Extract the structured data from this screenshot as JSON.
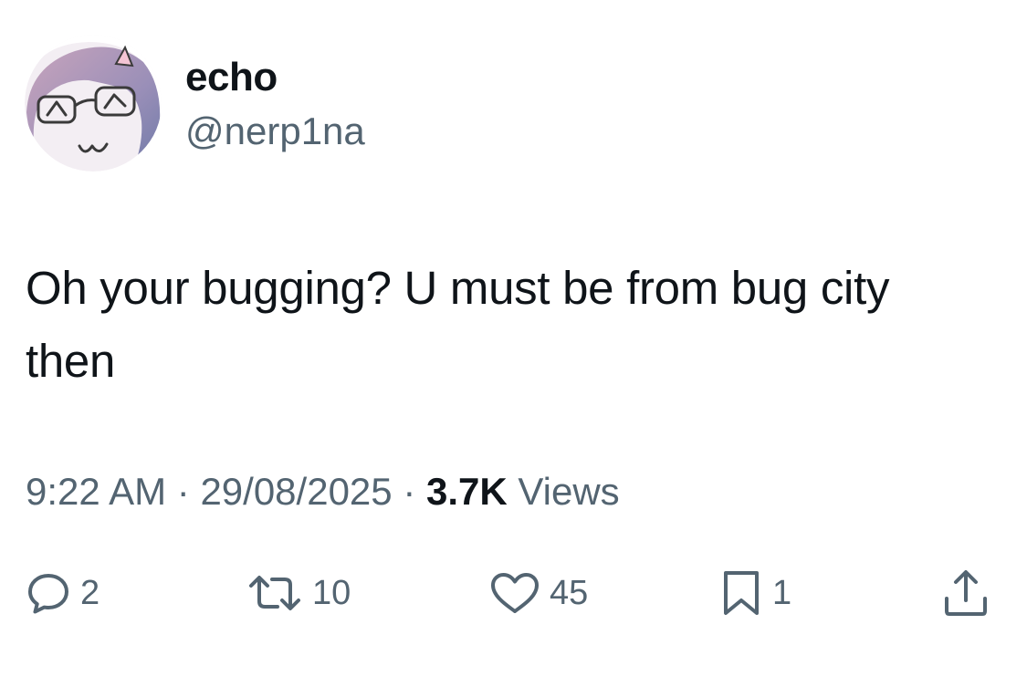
{
  "user": {
    "display_name": "echo",
    "handle": "@nerp1na"
  },
  "tweet": {
    "text": "Oh your bugging? U must be from bug city then"
  },
  "meta": {
    "time": "9:22 AM",
    "separator": " · ",
    "date": "29/08/2025",
    "views_count": "3.7K",
    "views_label": " Views"
  },
  "actions": {
    "reply": {
      "icon": "reply-icon",
      "count": "2"
    },
    "retweet": {
      "icon": "retweet-icon",
      "count": "10"
    },
    "like": {
      "icon": "heart-icon",
      "count": "45"
    },
    "bookmark": {
      "icon": "bookmark-icon",
      "count": "1"
    },
    "share": {
      "icon": "share-icon"
    }
  },
  "colors": {
    "text_primary": "#0f1419",
    "text_secondary": "#536471",
    "icon": "#536471",
    "background": "#ffffff"
  }
}
